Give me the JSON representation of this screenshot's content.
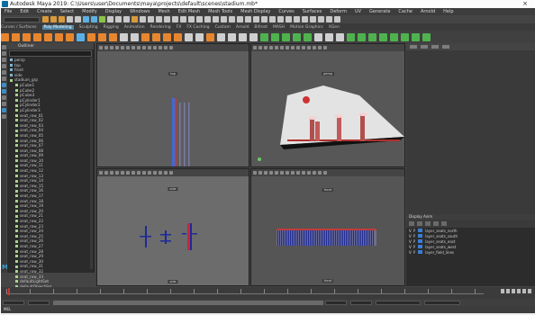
{
  "window": {
    "title": "Autodesk Maya 2019: C:\\Users\\user\\Documents\\maya\\projects\\default\\scenes\\stadium.mb*",
    "close_glyph": "×"
  },
  "menubar": {
    "items": [
      "File",
      "Edit",
      "Create",
      "Select",
      "Modify",
      "Display",
      "Windows",
      "Mesh",
      "Edit Mesh",
      "Mesh Tools",
      "Mesh Display",
      "Curves",
      "Surfaces",
      "Deform",
      "UV",
      "Generate",
      "Cache",
      "Arnold",
      "Help"
    ]
  },
  "status_line": {
    "mode": "Modeling",
    "icon_colors": [
      "#d89a3a",
      "#d89a3a",
      "#d89a3a",
      "#c8c8c8",
      "#c8c8c8",
      "#5fb0e0",
      "#5fb0e0",
      "#8bc34a",
      "#c8c8c8",
      "#c8c8c8",
      "#c8c8c8",
      "#d89a3a",
      "#c8c8c8",
      "#c8c8c8",
      "#c8c8c8",
      "#c8c8c8",
      "#c8c8c8",
      "#c8c8c8",
      "#c8c8c8",
      "#c8c8c8",
      "#c8c8c8",
      "#c8c8c8",
      "#c8c8c8",
      "#c8c8c8",
      "#c8c8c8",
      "#c8c8c8",
      "#c8c8c8",
      "#c8c8c8",
      "#c8c8c8",
      "#c8c8c8",
      "#c8c8c8",
      "#c8c8c8",
      "#c8c8c8",
      "#c8c8c8",
      "#c8c8c8",
      "#c8c8c8",
      "#c8c8c8"
    ]
  },
  "shelf": {
    "tabs": [
      "Curves / Surfaces",
      "Poly Modeling",
      "Sculpting",
      "Rigging",
      "Animation",
      "Rendering",
      "FX",
      "FX Caching",
      "Custom",
      "Arnold",
      "Bifrost",
      "MASH",
      "Motion Graphics",
      "XGen"
    ],
    "active_tab_index": 1,
    "icon_colors": [
      "#e8862f",
      "#e8862f",
      "#e8862f",
      "#e8862f",
      "#e8862f",
      "#e8862f",
      "#e8862f",
      "#5ab0e6",
      "#e8862f",
      "#e8862f",
      "#e8862f",
      "#cfcfcf",
      "#cfcfcf",
      "#e8862f",
      "#e8862f",
      "#e8862f",
      "#e8862f",
      "#cfcfcf",
      "#cfcfcf",
      "#e8862f",
      "#cfcfcf",
      "#cfcfcf",
      "#cfcfcf",
      "#cfcfcf",
      "#4fb24f",
      "#4fb24f",
      "#4fb24f",
      "#4fb24f",
      "#4fb24f",
      "#cfcfcf",
      "#cfcfcf",
      "#cfcfcf",
      "#4fb24f",
      "#4fb24f",
      "#4fb24f",
      "#4fb24f",
      "#4fb24f",
      "#4fb24f",
      "#4fb24f",
      "#4fb24f"
    ]
  },
  "outliner": {
    "header": "Outliner",
    "items": [
      "persp",
      "top",
      "front",
      "side",
      "stadium_grp",
      "pCube1",
      "pCube2",
      "pCube3",
      "pCylinder1",
      "pCylinder2",
      "pCylinder3",
      "seat_row_01",
      "seat_row_02",
      "seat_row_03",
      "seat_row_04",
      "seat_row_05",
      "seat_row_06",
      "seat_row_07",
      "seat_row_08",
      "seat_row_09",
      "seat_row_10",
      "seat_row_11",
      "seat_row_12",
      "seat_row_13",
      "seat_row_14",
      "seat_row_15",
      "seat_row_16",
      "seat_row_17",
      "seat_row_18",
      "seat_row_19",
      "seat_row_20",
      "seat_row_21",
      "seat_row_22",
      "seat_row_23",
      "seat_row_24",
      "seat_row_25",
      "seat_row_26",
      "seat_row_27",
      "seat_row_28",
      "seat_row_29",
      "seat_row_30",
      "seat_row_31",
      "seat_row_32",
      "seat_row_33",
      "defaultLightSet",
      "defaultObjectSet"
    ]
  },
  "viewports": {
    "top": {
      "label": "top"
    },
    "persp": {
      "label": "persp"
    },
    "side": {
      "label": "side"
    },
    "front": {
      "label": "front"
    }
  },
  "layers": {
    "header": "Display  Anim",
    "rows": [
      {
        "v": "V",
        "p": "P",
        "color": "#3a7fd5",
        "name": "layer_seats_north"
      },
      {
        "v": "V",
        "p": "P",
        "color": "#3a7fd5",
        "name": "layer_seats_south"
      },
      {
        "v": "V",
        "p": "P",
        "color": "#3a7fd5",
        "name": "layer_seats_east"
      },
      {
        "v": "V",
        "p": "P",
        "color": "#3a7fd5",
        "name": "layer_seats_west"
      },
      {
        "v": "V",
        "p": "P",
        "color": "#3a7fd5",
        "name": "layer_field_lines"
      }
    ]
  },
  "timeline": {
    "start": "1",
    "end": "120",
    "range_start": "1",
    "range_end": "200",
    "current_frame": "1"
  },
  "command_line": {
    "label": "MEL"
  }
}
